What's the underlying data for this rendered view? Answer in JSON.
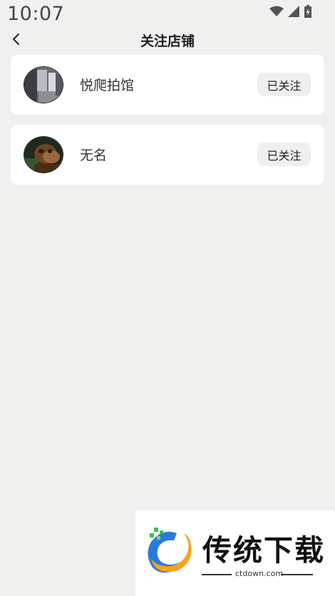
{
  "status_bar": {
    "time": "10:07",
    "icons": [
      "wifi-icon",
      "signal-icon",
      "battery-icon"
    ]
  },
  "nav": {
    "back_icon": "chevron-left-icon",
    "title": "关注店铺"
  },
  "shops": [
    {
      "name": "悦爬拍馆",
      "button_label": "已关注",
      "avatar": "shop-photo-room"
    },
    {
      "name": "无名",
      "button_label": "已关注",
      "avatar": "shop-photo-monkey"
    }
  ],
  "watermark": {
    "title": "传统下载",
    "url": "ctdown.com",
    "colors": {
      "blue": "#2a7bd9",
      "orange": "#f7a21b",
      "green": "#3fbf5a"
    }
  }
}
